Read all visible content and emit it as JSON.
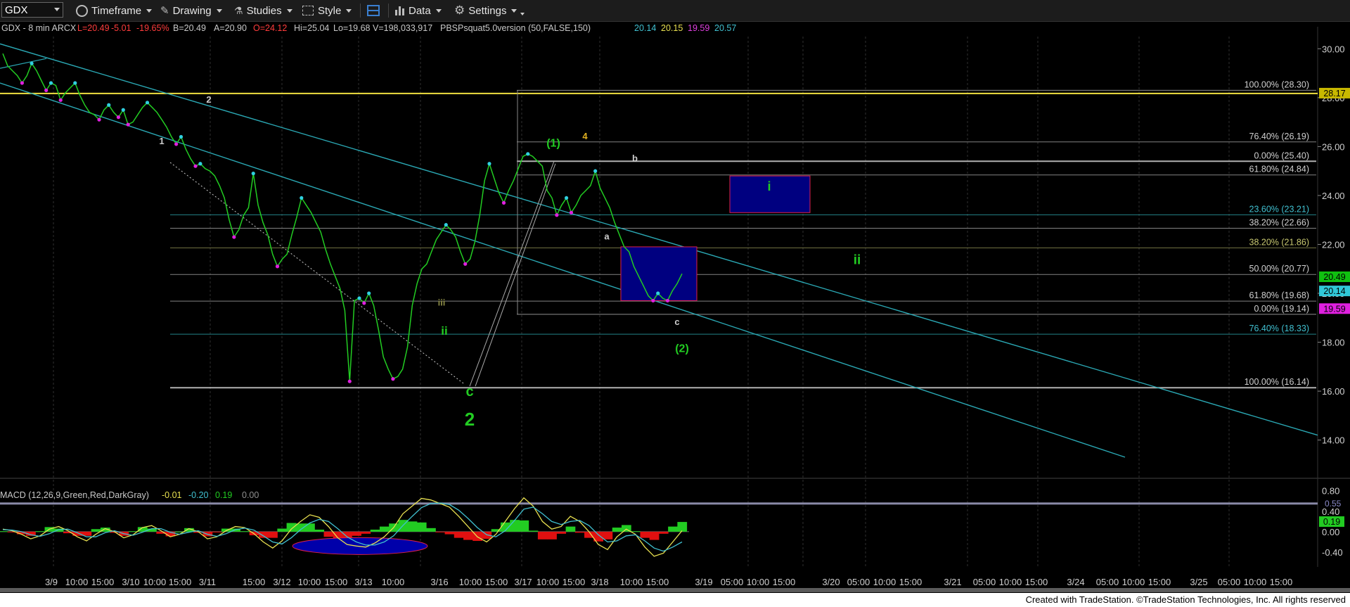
{
  "toolbar": {
    "symbol": "GDX",
    "timeframe": "Timeframe",
    "drawing": "Drawing",
    "studies": "Studies",
    "style": "Style",
    "data": "Data",
    "settings": "Settings"
  },
  "colors": {
    "green": "#22cc22",
    "channel": "#2aa7b3",
    "yellow": "#f0e040",
    "magenta": "#e020e0",
    "cyan": "#30d0e0",
    "box": "#000080",
    "boxBorder": "#e0204a"
  },
  "header": {
    "items": [
      {
        "text": "GDX - 8 min  ARCX",
        "color": "#c8c8c8"
      },
      {
        "text": "L=20.49",
        "color": "#ff3c3c"
      },
      {
        "text": "-5.01",
        "color": "#ff3c3c"
      },
      {
        "text": "-19.65%",
        "color": "#ff3c3c"
      },
      {
        "text": "B=20.49",
        "color": "#c8c8c8"
      },
      {
        "text": "A=20.90",
        "color": "#c8c8c8"
      },
      {
        "text": "O=24.12",
        "color": "#ff3c3c"
      },
      {
        "text": "Hi=25.04",
        "color": "#c8c8c8"
      },
      {
        "text": "Lo=19.68",
        "color": "#c8c8c8"
      },
      {
        "text": "V=198,033,917",
        "color": "#c8c8c8"
      },
      {
        "text": "PBSPsquat5.0version (50,FALSE,150)",
        "color": "#c8c8c8"
      },
      {
        "text": "20.14",
        "color": "#40c0d0"
      },
      {
        "text": "20.15",
        "color": "#e8e050"
      },
      {
        "text": "19.59",
        "color": "#e040e0"
      },
      {
        "text": "20.57",
        "color": "#40c0d0"
      }
    ]
  },
  "chart_data": [
    {
      "type": "line",
      "title": "GDX - 8 min",
      "ylim": [
        13.3,
        30.9
      ],
      "y_ticks": [
        14.0,
        16.0,
        18.0,
        20.0,
        22.0,
        24.0,
        26.0,
        28.0,
        30.0
      ],
      "y_tick_labels": [
        "14.00",
        "16.00",
        "18.00",
        "20.00",
        "22.00",
        "24.00",
        "26.00",
        "28.00",
        "30.00"
      ],
      "x_labels": [
        "3/9",
        "10:00",
        "15:00",
        "3/10",
        "10:00",
        "15:00",
        "3/11",
        "15:00",
        "3/12",
        "10:00",
        "15:00",
        "3/13",
        "10:00",
        "3/16",
        "10:00",
        "15:00",
        "3/17",
        "10:00",
        "15:00",
        "3/18",
        "10:00",
        "15:00",
        "3/19",
        "05:00",
        "10:00",
        "15:00",
        "3/20",
        "05:00",
        "10:00",
        "15:00",
        "3/21",
        "05:00",
        "10:00",
        "15:00",
        "3/24",
        "05:00",
        "10:00",
        "15:00",
        "3/25",
        "05:00",
        "10:00",
        "15:00"
      ],
      "series": [
        {
          "values": [
            29.8,
            29.3,
            29.1,
            28.9,
            28.6,
            28.9,
            29.4,
            29.1,
            28.7,
            28.3,
            28.6,
            28.5,
            27.9,
            28.2,
            28.4,
            28.6,
            28.1,
            27.7,
            27.4,
            27.3,
            27.1,
            27.5,
            27.7,
            27.4,
            27.2,
            27.5,
            26.9,
            27.0,
            27.3,
            27.6,
            27.8,
            27.6,
            27.4,
            27.1,
            26.8,
            26.4,
            26.1,
            26.4,
            25.9,
            25.5,
            25.2,
            25.3,
            25.1,
            25.0,
            24.8,
            24.4,
            23.9,
            23.0,
            22.3,
            22.6,
            23.2,
            23.5,
            24.9,
            23.6,
            22.9,
            22.4,
            21.6,
            21.1,
            21.4,
            21.6,
            22.4,
            23.1,
            23.9,
            23.6,
            23.3,
            22.9,
            22.5,
            21.8,
            21.2,
            20.7,
            20.2,
            19.3,
            16.4,
            19.7,
            19.8,
            19.6,
            20.0,
            19.5,
            18.5,
            17.4,
            16.9,
            16.5,
            16.6,
            16.9,
            17.8,
            19.5,
            20.4,
            21.0,
            21.2,
            21.7,
            22.2,
            22.5,
            22.8,
            22.6,
            22.3,
            21.7,
            21.2,
            21.4,
            22.1,
            23.2,
            24.6,
            25.3,
            24.7,
            24.1,
            23.7,
            24.2,
            24.6,
            25.1,
            25.6,
            25.7,
            25.6,
            25.4,
            25.2,
            24.2,
            23.9,
            23.2,
            23.6,
            23.9,
            23.3,
            23.6,
            24.0,
            24.2,
            24.4,
            25.0,
            24.3,
            23.9,
            23.5,
            22.9,
            22.4,
            21.9,
            21.7,
            21.1,
            20.7,
            20.3,
            19.9,
            19.7,
            20.0,
            19.8,
            19.7,
            20.1,
            20.4,
            20.8
          ]
        }
      ],
      "price_labels": [
        {
          "text": "28.17",
          "y": 28.17,
          "bg": "#c8b800",
          "fg": "#000000"
        },
        {
          "text": "20.49",
          "y": 20.49,
          "bg": "#10c010",
          "fg": "#000000"
        },
        {
          "text": "20.14",
          "y": 20.14,
          "bg": "#30c8d8",
          "fg": "#000000"
        },
        {
          "text": "19.59",
          "y": 19.59,
          "bg": "#e020e0",
          "fg": "#000000"
        }
      ],
      "fib_labels": [
        {
          "text": "100.00% (28.30)",
          "y": 28.3
        },
        {
          "text": "76.40% (26.19)",
          "y": 26.19
        },
        {
          "text": "0.00% (25.40)",
          "y": 25.4
        },
        {
          "text": "61.80% (24.84)",
          "y": 24.84
        },
        {
          "text": "23.60% (23.21)",
          "y": 23.21
        },
        {
          "text": "38.20% (22.66)",
          "y": 22.66
        },
        {
          "text": "38.20% (21.86)",
          "y": 21.86
        },
        {
          "text": "50.00% (20.77)",
          "y": 20.77
        },
        {
          "text": "61.80% (19.68)",
          "y": 19.68
        },
        {
          "text": "0.00% (19.14)",
          "y": 19.14
        },
        {
          "text": "76.40% (18.33)",
          "y": 18.33
        },
        {
          "text": "100.00% (16.14)",
          "y": 16.14
        }
      ],
      "wave_labels": [
        {
          "text": "1",
          "color": "#cccccc"
        },
        {
          "text": "2",
          "color": "#cccccc"
        },
        {
          "text": "iii",
          "color": "#888844"
        },
        {
          "text": "ii",
          "color": "#22cc22"
        },
        {
          "text": "c",
          "color": "#22cc22"
        },
        {
          "text": "2",
          "color": "#22cc22"
        },
        {
          "text": "(1)",
          "color": "#22cc22"
        },
        {
          "text": "4",
          "color": "#e0b020"
        },
        {
          "text": "a",
          "color": "#cccccc"
        },
        {
          "text": "b",
          "color": "#cccccc"
        },
        {
          "text": "c",
          "color": "#cccccc"
        },
        {
          "text": "(2)",
          "color": "#22cc22"
        },
        {
          "text": "i",
          "color": "#22cc22"
        },
        {
          "text": "ii",
          "color": "#22cc22"
        }
      ]
    },
    {
      "type": "line",
      "title": "MACD (12,26,9,Green,Red,DarkGray)",
      "header_values": [
        {
          "text": "-0.01",
          "color": "#e8e050"
        },
        {
          "text": "-0.20",
          "color": "#40c0d0"
        },
        {
          "text": "0.19",
          "color": "#22cc22"
        },
        {
          "text": "0.00",
          "color": "#909090"
        }
      ],
      "ylim": [
        -0.55,
        0.85
      ],
      "y_ticks": [
        0.8,
        0.4,
        0.0,
        -0.4
      ],
      "y_tick_labels": [
        "0.80",
        "0.40",
        "0.00",
        "-0.40"
      ],
      "level_label": "0.55",
      "last_value_label": "0.19",
      "series": [
        {
          "name": "MACD",
          "color": "#e8e050",
          "values": [
            0.05,
            0.02,
            -0.05,
            -0.14,
            -0.08,
            0.05,
            0.1,
            0.02,
            -0.1,
            -0.18,
            -0.05,
            0.06,
            0.0,
            -0.12,
            -0.06,
            0.08,
            0.12,
            0.02,
            -0.1,
            -0.05,
            0.06,
            0.0,
            -0.14,
            -0.1,
            0.02,
            0.1,
            0.08,
            -0.04,
            -0.2,
            -0.32,
            -0.18,
            0.05,
            0.2,
            0.33,
            0.28,
            0.1,
            -0.12,
            -0.25,
            -0.28,
            -0.3,
            -0.22,
            -0.1,
            0.08,
            0.35,
            0.5,
            0.65,
            0.62,
            0.55,
            0.48,
            0.3,
            0.1,
            -0.1,
            -0.2,
            -0.05,
            0.2,
            0.45,
            0.66,
            0.5,
            0.2,
            0.05,
            0.1,
            0.3,
            0.2,
            0.0,
            -0.25,
            -0.35,
            -0.1,
            0.05,
            -0.05,
            -0.3,
            -0.48,
            -0.42,
            -0.2,
            0.02
          ]
        },
        {
          "name": "Signal",
          "color": "#40c0d0",
          "values": [
            0.04,
            0.03,
            0.0,
            -0.06,
            -0.09,
            -0.04,
            0.04,
            0.05,
            -0.02,
            -0.1,
            -0.1,
            -0.02,
            0.02,
            -0.04,
            -0.07,
            -0.01,
            0.06,
            0.06,
            -0.01,
            -0.05,
            -0.01,
            0.02,
            -0.05,
            -0.09,
            -0.04,
            0.04,
            0.07,
            0.03,
            -0.08,
            -0.2,
            -0.24,
            -0.12,
            0.04,
            0.17,
            0.24,
            0.2,
            0.06,
            -0.1,
            -0.2,
            -0.26,
            -0.26,
            -0.2,
            -0.08,
            0.12,
            0.3,
            0.47,
            0.55,
            0.56,
            0.53,
            0.42,
            0.26,
            0.08,
            -0.06,
            -0.1,
            0.02,
            0.22,
            0.44,
            0.48,
            0.35,
            0.2,
            0.14,
            0.2,
            0.22,
            0.12,
            -0.06,
            -0.2,
            -0.18,
            -0.08,
            -0.06,
            -0.18,
            -0.32,
            -0.38,
            -0.3,
            -0.2
          ]
        },
        {
          "name": "Histogram",
          "values": [
            0.01,
            -0.01,
            -0.05,
            -0.08,
            0.01,
            0.09,
            0.06,
            -0.03,
            -0.08,
            -0.08,
            0.05,
            0.08,
            -0.02,
            -0.08,
            0.01,
            0.09,
            0.06,
            -0.04,
            -0.09,
            0.0,
            0.07,
            -0.02,
            -0.09,
            -0.01,
            0.06,
            0.06,
            0.01,
            -0.07,
            -0.12,
            -0.12,
            0.06,
            0.17,
            0.16,
            0.16,
            0.04,
            -0.1,
            -0.18,
            -0.15,
            -0.08,
            -0.04,
            0.04,
            0.1,
            0.16,
            0.23,
            0.2,
            0.18,
            0.07,
            -0.01,
            -0.05,
            -0.12,
            -0.16,
            -0.18,
            -0.14,
            0.05,
            0.18,
            0.23,
            0.22,
            0.02,
            -0.15,
            -0.15,
            -0.04,
            0.1,
            -0.02,
            -0.12,
            -0.19,
            -0.15,
            0.08,
            0.13,
            0.01,
            -0.12,
            -0.16,
            -0.04,
            0.1,
            0.19
          ]
        }
      ]
    }
  ],
  "footer": {
    "credit": "Created with TradeStation. ©TradeStation Technologies, Inc. All rights reserved"
  }
}
